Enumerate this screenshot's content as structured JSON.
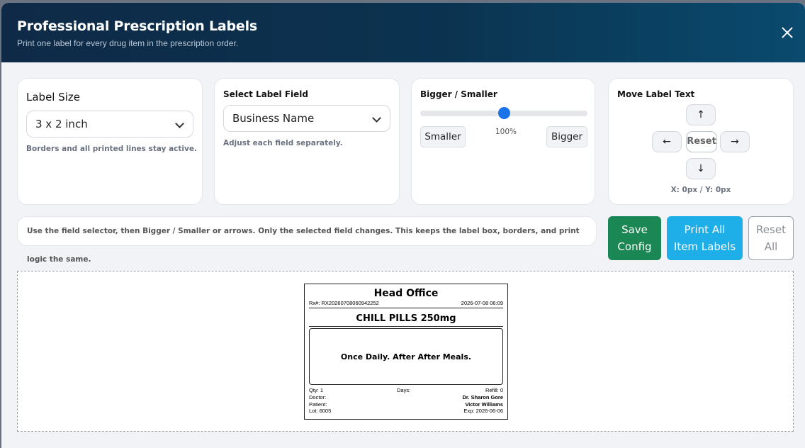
{
  "header": {
    "title": "Professional Prescription Labels",
    "subtitle": "Print one label for every drug item in the prescription order."
  },
  "label_size": {
    "title": "Label Size",
    "selected": "3 x 2 inch",
    "hint": "Borders and all printed lines stay active."
  },
  "label_field": {
    "title": "Select Label Field",
    "selected": "Business Name",
    "hint": "Adjust each field separately."
  },
  "size_adjust": {
    "title": "Bigger / Smaller",
    "scale_percent": 100,
    "scale_label": "100%",
    "smaller_label": "Smaller",
    "bigger_label": "Bigger"
  },
  "move_text": {
    "title": "Move Label Text",
    "up": "↑",
    "down": "↓",
    "left": "←",
    "right": "→",
    "reset": "Reset",
    "coords": "X: 0px / Y: 0px"
  },
  "instructions": "Use the field selector, then Bigger / Smaller or arrows. Only the selected field changes. This keeps the label box, borders, and print logic the same.",
  "actions": {
    "save_line1": "Save",
    "save_line2": "Config",
    "print_line1": "Print All",
    "print_line2": "Item Labels",
    "reset_line1": "Reset",
    "reset_line2": "All"
  },
  "label": {
    "business": "Head Office",
    "rx": "Rx#: RX20260708060942252",
    "datetime": "2026-07-08 06:09",
    "drug": "CHILL PILLS 250mg",
    "directions": "Once Daily. After After Meals.",
    "qty": "Qty: 1",
    "days": "Days:",
    "refill": "Refill: 0",
    "doctor_label": "Doctor:",
    "doctor": "Dr. Sharon Gore",
    "patient_label": "Patient:",
    "patient": "Victor Williams",
    "lot": "Lot: 6005",
    "exp": "Exp: 2026-06-06"
  },
  "colors": {
    "save": "#1a8754",
    "print": "#1eaee8",
    "accent": "#1a73e8"
  }
}
